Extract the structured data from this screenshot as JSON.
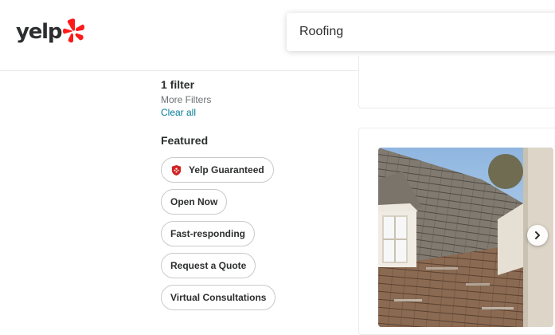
{
  "header": {
    "logo_text": "yelp",
    "search_value": "Roofing"
  },
  "filters": {
    "count_label": "1 filter",
    "more_filters_label": "More Filters",
    "clear_all_label": "Clear all",
    "featured_title": "Featured",
    "featured_pills": [
      {
        "label": "Yelp Guaranteed",
        "icon": "yelp-guaranteed-shield-icon"
      },
      {
        "label": "Open Now"
      },
      {
        "label": "Fast-responding"
      },
      {
        "label": "Request a Quote"
      },
      {
        "label": "Virtual Consultations"
      }
    ]
  },
  "result_card": {
    "photo": "roof-photo",
    "next_icon": "chevron-right-icon"
  },
  "colors": {
    "brand_red": "#ff1a1a",
    "link_teal": "#027a97",
    "guarantee_red": "#d32323"
  }
}
